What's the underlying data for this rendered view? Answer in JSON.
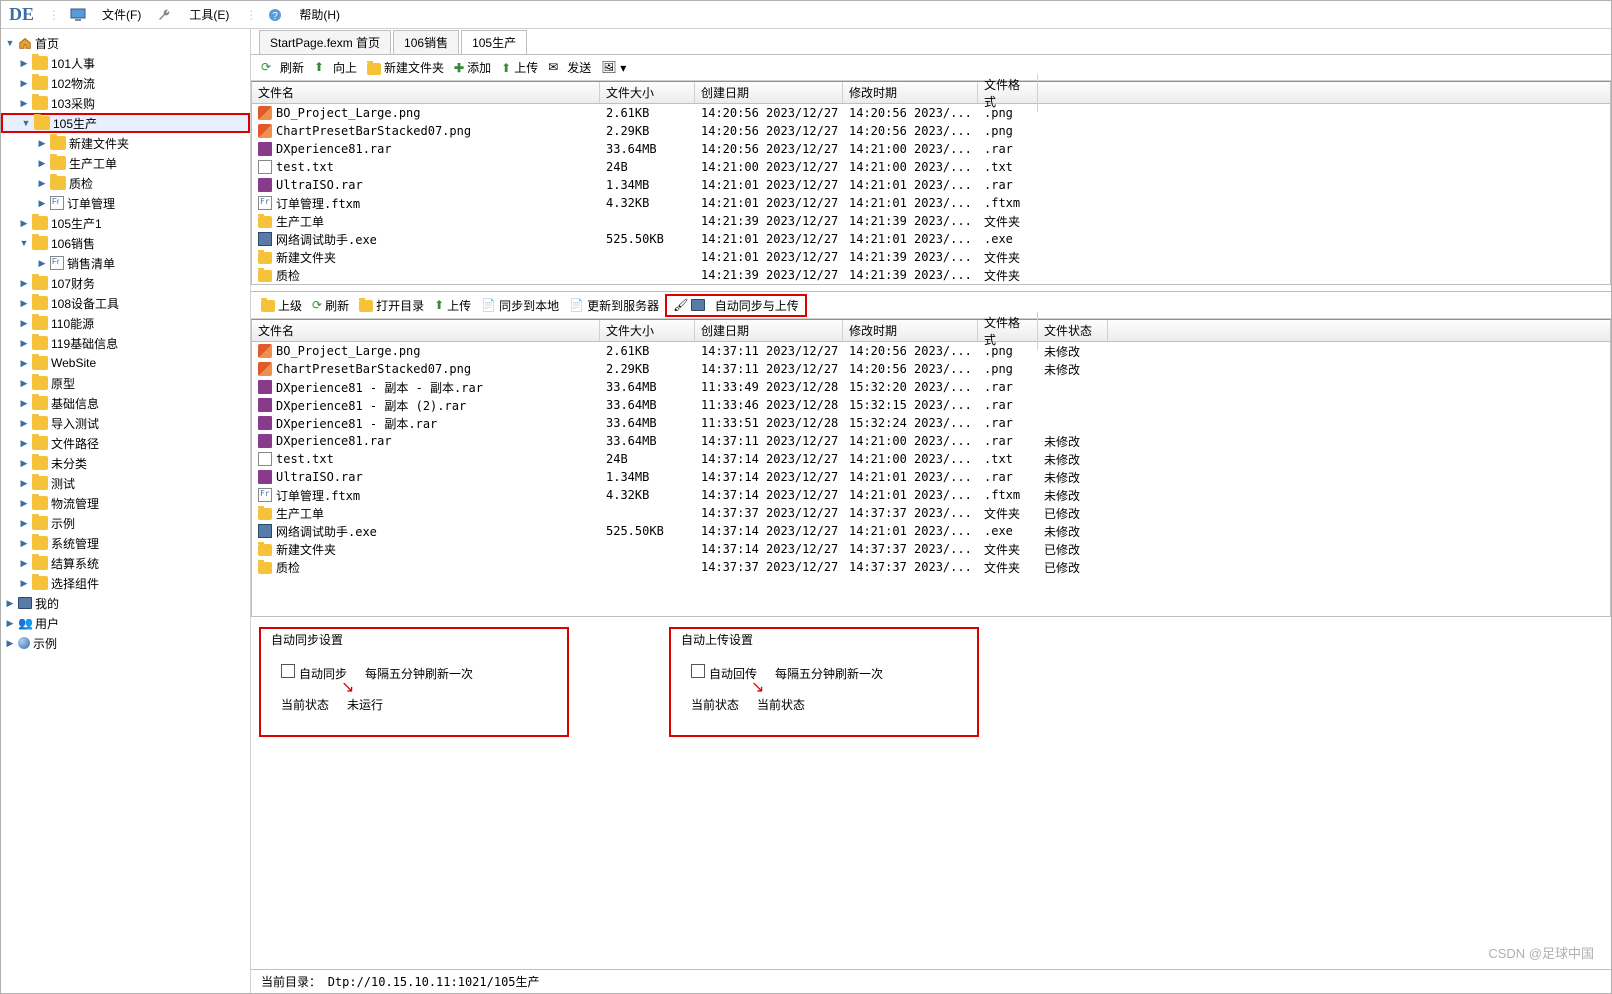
{
  "app": {
    "logo": "DE"
  },
  "menu": {
    "file": "文件(F)",
    "tools": "工具(E)",
    "help": "帮助(H)"
  },
  "tree": {
    "root": "首页",
    "items": [
      {
        "label": "101人事",
        "expand": false,
        "level": 1
      },
      {
        "label": "102物流",
        "expand": false,
        "level": 1
      },
      {
        "label": "103采购",
        "expand": false,
        "level": 1
      },
      {
        "label": "105生产",
        "expand": true,
        "level": 1,
        "selected": true,
        "boxed": true
      },
      {
        "label": "新建文件夹",
        "expand": false,
        "level": 2
      },
      {
        "label": "生产工单",
        "expand": false,
        "level": 2
      },
      {
        "label": "质检",
        "expand": false,
        "level": 2
      },
      {
        "label": "订单管理",
        "expand": false,
        "level": 2,
        "icon": "form"
      },
      {
        "label": "105生产1",
        "expand": false,
        "level": 1
      },
      {
        "label": "106销售",
        "expand": true,
        "level": 1
      },
      {
        "label": "销售清单",
        "expand": false,
        "level": 2,
        "icon": "form"
      },
      {
        "label": "107财务",
        "expand": false,
        "level": 1
      },
      {
        "label": "108设备工具",
        "expand": false,
        "level": 1
      },
      {
        "label": "110能源",
        "expand": false,
        "level": 1
      },
      {
        "label": "119基础信息",
        "expand": false,
        "level": 1
      },
      {
        "label": "WebSite",
        "expand": false,
        "level": 1
      },
      {
        "label": "原型",
        "expand": false,
        "level": 1
      },
      {
        "label": "基础信息",
        "expand": false,
        "level": 1
      },
      {
        "label": "导入测试",
        "expand": false,
        "level": 1
      },
      {
        "label": "文件路径",
        "expand": false,
        "level": 1
      },
      {
        "label": "未分类",
        "expand": false,
        "level": 1
      },
      {
        "label": "测试",
        "expand": false,
        "level": 1
      },
      {
        "label": "物流管理",
        "expand": false,
        "level": 1
      },
      {
        "label": "示例",
        "expand": false,
        "level": 1
      },
      {
        "label": "系统管理",
        "expand": false,
        "level": 1
      },
      {
        "label": "结算系统",
        "expand": false,
        "level": 1
      },
      {
        "label": "选择组件",
        "expand": false,
        "level": 1
      }
    ],
    "bottom": [
      {
        "label": "我的",
        "icon": "monitor"
      },
      {
        "label": "用户",
        "icon": "users"
      },
      {
        "label": "示例",
        "icon": "ball"
      }
    ]
  },
  "tabs": [
    {
      "label": "StartPage.fexm 首页",
      "active": false
    },
    {
      "label": "106销售",
      "active": false
    },
    {
      "label": "105生产",
      "active": true
    }
  ],
  "toolbar1": {
    "refresh": "刷新",
    "up": "向上",
    "newfolder": "新建文件夹",
    "add": "添加",
    "upload": "上传",
    "send": "发送"
  },
  "grid1": {
    "headers": {
      "name": "文件名",
      "size": "文件大小",
      "cdate": "创建日期",
      "mdate": "修改时期",
      "fmt": "文件格式"
    },
    "rows": [
      {
        "name": "BO_Project_Large.png",
        "size": "2.61KB",
        "cdate": "14:20:56 2023/12/27",
        "mdate": "14:20:56 2023/...",
        "fmt": ".png",
        "ft": "png"
      },
      {
        "name": "ChartPresetBarStacked07.png",
        "size": "2.29KB",
        "cdate": "14:20:56 2023/12/27",
        "mdate": "14:20:56 2023/...",
        "fmt": ".png",
        "ft": "png"
      },
      {
        "name": "DXperience81.rar",
        "size": "33.64MB",
        "cdate": "14:20:56 2023/12/27",
        "mdate": "14:21:00 2023/...",
        "fmt": ".rar",
        "ft": "rar"
      },
      {
        "name": "test.txt",
        "size": "24B",
        "cdate": "14:21:00 2023/12/27",
        "mdate": "14:21:00 2023/...",
        "fmt": ".txt",
        "ft": "txt"
      },
      {
        "name": "UltraISO.rar",
        "size": "1.34MB",
        "cdate": "14:21:01 2023/12/27",
        "mdate": "14:21:01 2023/...",
        "fmt": ".rar",
        "ft": "rar"
      },
      {
        "name": "订单管理.ftxm",
        "size": "4.32KB",
        "cdate": "14:21:01 2023/12/27",
        "mdate": "14:21:01 2023/...",
        "fmt": ".ftxm",
        "ft": "ftxm"
      },
      {
        "name": "生产工单",
        "size": "",
        "cdate": "14:21:39 2023/12/27",
        "mdate": "14:21:39 2023/...",
        "fmt": "文件夹",
        "ft": "folder"
      },
      {
        "name": "网络调试助手.exe",
        "size": "525.50KB",
        "cdate": "14:21:01 2023/12/27",
        "mdate": "14:21:01 2023/...",
        "fmt": ".exe",
        "ft": "exe"
      },
      {
        "name": "新建文件夹",
        "size": "",
        "cdate": "14:21:01 2023/12/27",
        "mdate": "14:21:39 2023/...",
        "fmt": "文件夹",
        "ft": "folder"
      },
      {
        "name": "质检",
        "size": "",
        "cdate": "14:21:39 2023/12/27",
        "mdate": "14:21:39 2023/...",
        "fmt": "文件夹",
        "ft": "folder"
      }
    ]
  },
  "toolbar2": {
    "uplevel": "上级",
    "refresh": "刷新",
    "opendir": "打开目录",
    "upload": "上传",
    "synclocal": "同步到本地",
    "updateserver": "更新到服务器",
    "autosync": "自动同步与上传"
  },
  "grid2": {
    "headers": {
      "name": "文件名",
      "size": "文件大小",
      "cdate": "创建日期",
      "mdate": "修改时期",
      "fmt": "文件格式",
      "stat": "文件状态"
    },
    "rows": [
      {
        "name": "BO_Project_Large.png",
        "size": "2.61KB",
        "cdate": "14:37:11 2023/12/27",
        "mdate": "14:20:56 2023/...",
        "fmt": ".png",
        "stat": "未修改",
        "ft": "png"
      },
      {
        "name": "ChartPresetBarStacked07.png",
        "size": "2.29KB",
        "cdate": "14:37:11 2023/12/27",
        "mdate": "14:20:56 2023/...",
        "fmt": ".png",
        "stat": "未修改",
        "ft": "png"
      },
      {
        "name": "DXperience81 - 副本 - 副本.rar",
        "size": "33.64MB",
        "cdate": "11:33:49 2023/12/28",
        "mdate": "15:32:20 2023/...",
        "fmt": ".rar",
        "stat": "",
        "ft": "rar"
      },
      {
        "name": "DXperience81 - 副本 (2).rar",
        "size": "33.64MB",
        "cdate": "11:33:46 2023/12/28",
        "mdate": "15:32:15 2023/...",
        "fmt": ".rar",
        "stat": "",
        "ft": "rar"
      },
      {
        "name": "DXperience81 - 副本.rar",
        "size": "33.64MB",
        "cdate": "11:33:51 2023/12/28",
        "mdate": "15:32:24 2023/...",
        "fmt": ".rar",
        "stat": "",
        "ft": "rar"
      },
      {
        "name": "DXperience81.rar",
        "size": "33.64MB",
        "cdate": "14:37:11 2023/12/27",
        "mdate": "14:21:00 2023/...",
        "fmt": ".rar",
        "stat": "未修改",
        "ft": "rar"
      },
      {
        "name": "test.txt",
        "size": "24B",
        "cdate": "14:37:14 2023/12/27",
        "mdate": "14:21:00 2023/...",
        "fmt": ".txt",
        "stat": "未修改",
        "ft": "txt"
      },
      {
        "name": "UltraISO.rar",
        "size": "1.34MB",
        "cdate": "14:37:14 2023/12/27",
        "mdate": "14:21:01 2023/...",
        "fmt": ".rar",
        "stat": "未修改",
        "ft": "rar"
      },
      {
        "name": "订单管理.ftxm",
        "size": "4.32KB",
        "cdate": "14:37:14 2023/12/27",
        "mdate": "14:21:01 2023/...",
        "fmt": ".ftxm",
        "stat": "未修改",
        "ft": "ftxm"
      },
      {
        "name": "生产工单",
        "size": "",
        "cdate": "14:37:37 2023/12/27",
        "mdate": "14:37:37 2023/...",
        "fmt": "文件夹",
        "stat": "已修改",
        "ft": "folder"
      },
      {
        "name": "网络调试助手.exe",
        "size": "525.50KB",
        "cdate": "14:37:14 2023/12/27",
        "mdate": "14:21:01 2023/...",
        "fmt": ".exe",
        "stat": "未修改",
        "ft": "exe"
      },
      {
        "name": "新建文件夹",
        "size": "",
        "cdate": "14:37:14 2023/12/27",
        "mdate": "14:37:37 2023/...",
        "fmt": "文件夹",
        "stat": "已修改",
        "ft": "folder"
      },
      {
        "name": "质检",
        "size": "",
        "cdate": "14:37:37 2023/12/27",
        "mdate": "14:37:37 2023/...",
        "fmt": "文件夹",
        "stat": "已修改",
        "ft": "folder"
      }
    ]
  },
  "settings": {
    "sync": {
      "title": "自动同步设置",
      "chk": "自动同步",
      "hint": "每隔五分钟刷新一次",
      "state_lbl": "当前状态",
      "state_val": "未运行"
    },
    "upload": {
      "title": "自动上传设置",
      "chk": "自动回传",
      "hint": "每隔五分钟刷新一次",
      "state_lbl": "当前状态",
      "state_val": "当前状态"
    }
  },
  "status": {
    "label": "当前目录：",
    "path": "Dtp://10.15.10.11:1021/105生产"
  },
  "watermark": "CSDN @足球中国"
}
